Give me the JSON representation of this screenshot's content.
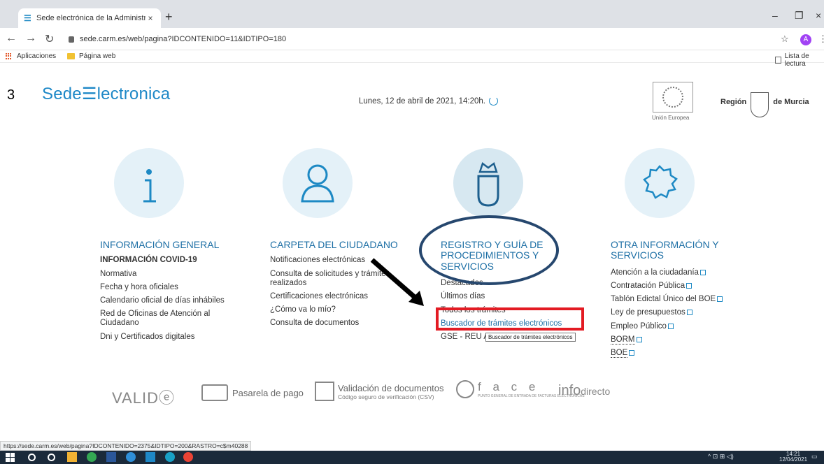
{
  "browser": {
    "tab_title": "Sede electrónica de la Administrac",
    "tab_favicon": "☰",
    "url": "sede.carm.es/web/pagina?IDCONTENIDO=11&IDTIPO=180",
    "avatar_letter": "A",
    "bookmarks": {
      "apps": "Aplicaciones",
      "folder": "Página web",
      "reading_list": "Lista de lectura"
    },
    "status_url": "https://sede.carm.es/web/pagina?IDCONTENIDO=2375&IDTIPO=200&RASTRO=c$m40288"
  },
  "annotation_number": "3",
  "header": {
    "logo": "Sede☰lectronica",
    "date": "Lunes, 12 de abril de 2021, 14:20h.",
    "eu_label": "Unión Europea",
    "region_left": "Región",
    "region_right": "de Murcia"
  },
  "icons": [
    "info-icon",
    "user-icon",
    "crown-crest-icon",
    "gear-icon"
  ],
  "columns": {
    "general": {
      "title": "INFORMACIÓN GENERAL",
      "items": [
        "INFORMACIÓN COVID-19",
        "Normativa",
        "Fecha y hora oficiales",
        "Calendario oficial de días inhábiles",
        "Red de Oficinas de Atención al Ciudadano",
        "Dni y Certificados digitales"
      ]
    },
    "carpeta": {
      "title": "CARPETA DEL CIUDADANO",
      "items": [
        "Notificaciones electrónicas",
        "Consulta de solicitudes y trámites realizados",
        "Certificaciones electrónicas",
        "¿Cómo va lo mío?",
        "Consulta de documentos"
      ]
    },
    "registro": {
      "title": "REGISTRO Y GUÍA DE PROCEDIMIENTOS Y SERVICIOS",
      "items": [
        "Destacados",
        "Últimos días",
        "Todos los trámites",
        "Buscador de trámites electrónicos",
        "GSE - REU A"
      ]
    },
    "otra": {
      "title": "OTRA INFORMACIÓN Y SERVICIOS",
      "items": [
        "Atención a la ciudadanía",
        "Contratación Pública",
        "Tablón Edictal Único del BOE",
        "Ley de presupuestos",
        "Empleo Público",
        "BORM",
        "BOE"
      ]
    }
  },
  "tooltip": "Buscador de trámites electrónicos",
  "partners": {
    "valide": "VALIDⓔ",
    "pasarela": "Pasarela de pago",
    "validacion_title": "Validación de documentos",
    "validacion_sub": "Código seguro de verificación (CSV)",
    "face": "f a c e",
    "face_sub": "PUNTO GENERAL DE ENTRADA DE FACTURAS ELECTRÓNICAS",
    "info_1": "info",
    "info_2": "directo"
  },
  "taskbar": {
    "time": "14:21",
    "date": "12/04/2021"
  },
  "colors": {
    "accent": "#1d89c4",
    "heading": "#1d6fa5",
    "highlight_box": "#e31b23",
    "oval": "#26476e"
  }
}
